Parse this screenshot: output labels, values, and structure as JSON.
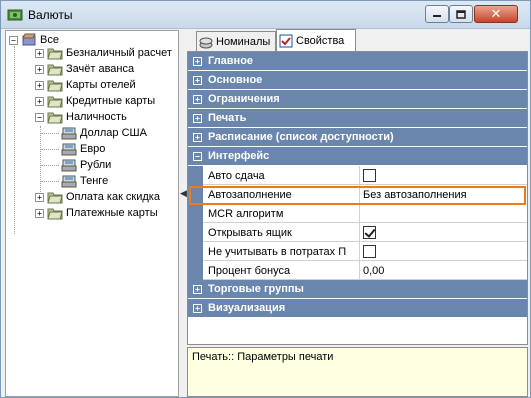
{
  "window": {
    "title": "Валюты"
  },
  "tree": {
    "root": "Все",
    "items": [
      {
        "label": "Безналичный расчет"
      },
      {
        "label": "Зачёт аванса"
      },
      {
        "label": "Карты отелей"
      },
      {
        "label": "Кредитные карты"
      },
      {
        "label": "Наличность"
      },
      {
        "label": "Доллар США"
      },
      {
        "label": "Евро"
      },
      {
        "label": "Рубли"
      },
      {
        "label": "Тенге"
      },
      {
        "label": "Оплата как скидка"
      },
      {
        "label": "Платежные карты"
      }
    ]
  },
  "tabs": [
    {
      "label": "Номиналы"
    },
    {
      "label": "Свойства"
    }
  ],
  "categories": {
    "main": "Главное",
    "basic": "Основное",
    "limits": "Ограничения",
    "print": "Печать",
    "schedule": "Расписание (список доступности)",
    "interface": "Интерфейс",
    "trade_groups": "Торговые группы",
    "visualization": "Визуализация"
  },
  "properties": [
    {
      "name": "Авто сдача",
      "value": "",
      "checked": false
    },
    {
      "name": "Автозаполнение",
      "value": "Без автозаполнения"
    },
    {
      "name": "MCR алгоритм",
      "value": ""
    },
    {
      "name": "Открывать ящик",
      "value": "",
      "checked": true
    },
    {
      "name": "Не учитывать в потратах П",
      "value": "",
      "checked": false
    },
    {
      "name": "Процент бонуса",
      "value": "0,00"
    }
  ],
  "description": "Печать:: Параметры печати",
  "colors": {
    "category_bg": "#6a86ad",
    "highlight": "#f07a18",
    "desc_bg": "#ffffe1"
  }
}
